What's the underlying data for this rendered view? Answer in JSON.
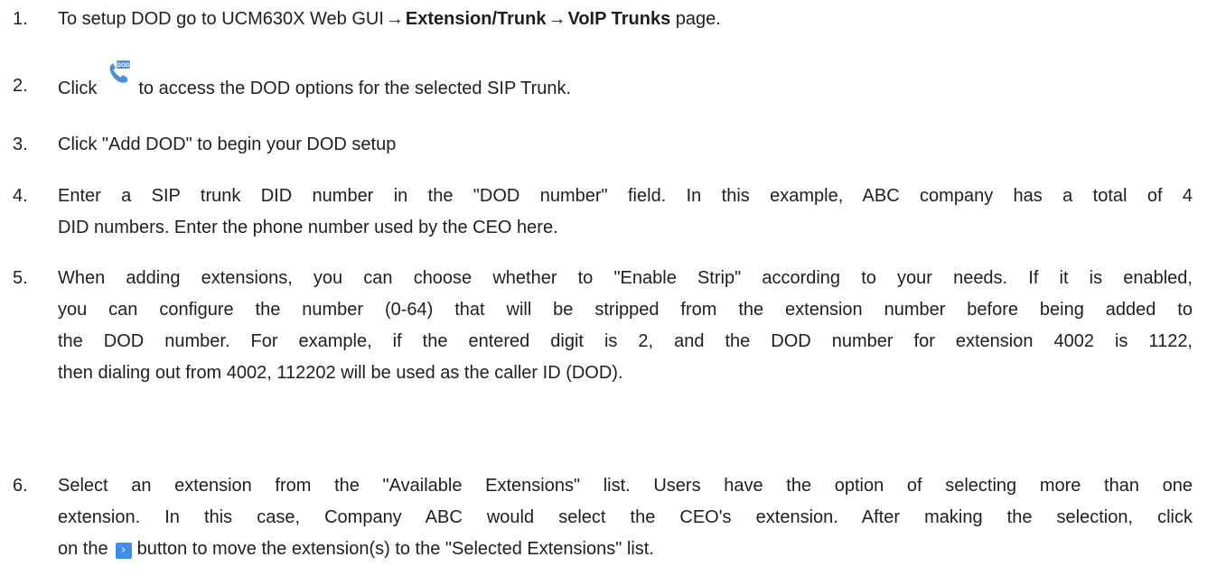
{
  "steps": [
    {
      "num": "1.",
      "pre": "To setup DOD go to UCM630X Web GUI",
      "bold1": "Extension/Trunk",
      "bold2": "VoIP Trunks",
      "post": " page."
    },
    {
      "num": "2.",
      "pre": "Click",
      "icon_label": "DOD",
      "post": "to access the DOD options for the selected SIP Trunk."
    },
    {
      "num": "3.",
      "text": "Click \"Add DOD\" to begin your DOD setup"
    },
    {
      "num": "4.",
      "lines": [
        "Enter a SIP trunk DID number in the \"DOD number\" field. In this example, ABC company has a total of 4",
        "DID numbers. Enter the phone number used by the CEO here."
      ]
    },
    {
      "num": "5.",
      "lines": [
        "When adding extensions, you can choose whether to \"Enable Strip\" according to your needs. If it is enabled,",
        "you can configure the number (0-64) that will be stripped from the extension number before being added to",
        "the DOD number. For example, if the entered digit is 2, and the DOD number for extension 4002 is 1122,",
        "then dialing out from 4002, 112202 will be used as the caller ID (DOD)."
      ]
    },
    {
      "num": "6.",
      "lines": [
        "Select an extension from the \"Available Extensions\" list. Users have the option of selecting more than one",
        "extension. In this case, Company ABC would select the CEO's extension. After making the selection, click"
      ],
      "last_pre": "on the",
      "button_glyph": "›",
      "last_post": "button to move the extension(s) to the \"Selected Extensions\" list."
    }
  ],
  "arrow_glyph": "→",
  "icon_names": {
    "dod": "phone-dod-icon",
    "move": "move-right-icon"
  },
  "colors": {
    "text": "#1f1f1f",
    "icon_blue": "#3d8fe8",
    "phone_blue": "#4a90d9"
  }
}
